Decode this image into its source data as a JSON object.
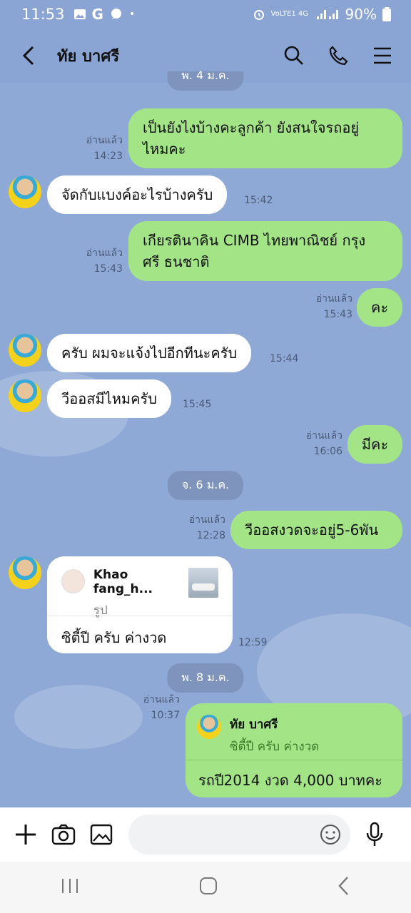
{
  "status": {
    "time": "11:53",
    "left_icons": [
      "image-icon",
      "g-icon",
      "chat-icon"
    ],
    "dot": "•",
    "network": "VoLTE1 4G",
    "battery": "90%"
  },
  "header": {
    "title": "ทัย บาศรี"
  },
  "date_top": "พ. 4 ม.ค.",
  "messages": [
    {
      "dir": "out",
      "text_line1": "เป็นยังไงบ้างคะลูกค้า ยังสนใจรถอยู่",
      "text_line2": "ไหมคะ",
      "read": "อ่านแล้ว",
      "time": "14:23"
    },
    {
      "dir": "in",
      "text": "จัดกับแบงค์อะไรบ้างครับ",
      "time": "15:42"
    },
    {
      "dir": "out",
      "text_line1": "เกียรตินาคิน CIMB ไทยพาณิชย์ กรุง",
      "text_line2": "ศรี ธนชาติ",
      "read": "อ่านแล้ว",
      "time": "15:43"
    },
    {
      "dir": "out",
      "text": "คะ",
      "read": "อ่านแล้ว",
      "time": "15:43"
    },
    {
      "dir": "in",
      "text": "ครับ ผมจะแจ้งไปอีกทีนะครับ",
      "time": "15:44"
    },
    {
      "dir": "in",
      "text": "วีออสมีไหมครับ",
      "time": "15:45"
    },
    {
      "dir": "out",
      "text": "มีคะ",
      "read": "อ่านแล้ว",
      "time": "16:06"
    }
  ],
  "date_mid": "จ. 6 ม.ค.",
  "messages2": [
    {
      "dir": "out",
      "text": "วีออสงวดจะอยู่5-6พัน",
      "read": "อ่านแล้ว",
      "time": "12:28"
    }
  ],
  "card": {
    "name": "Khao fang_h...",
    "sub": "รูป",
    "body": "ซิตี้ปี ครับ ค่างวด",
    "time": "12:59"
  },
  "date_bottom": "พ. 8 ม.ค.",
  "reply": {
    "name": "ทัย บาศรี",
    "quoted": "ซิตี้ปี ครับ ค่างวด",
    "body": "รถปี2014 งวด 4,000 บาทคะ",
    "read": "อ่านแล้ว",
    "time": "10:37"
  },
  "input": {
    "placeholder": ""
  },
  "colors": {
    "background": "#8fa9d6",
    "out_bubble": "#a3e487",
    "in_bubble": "#ffffff"
  }
}
